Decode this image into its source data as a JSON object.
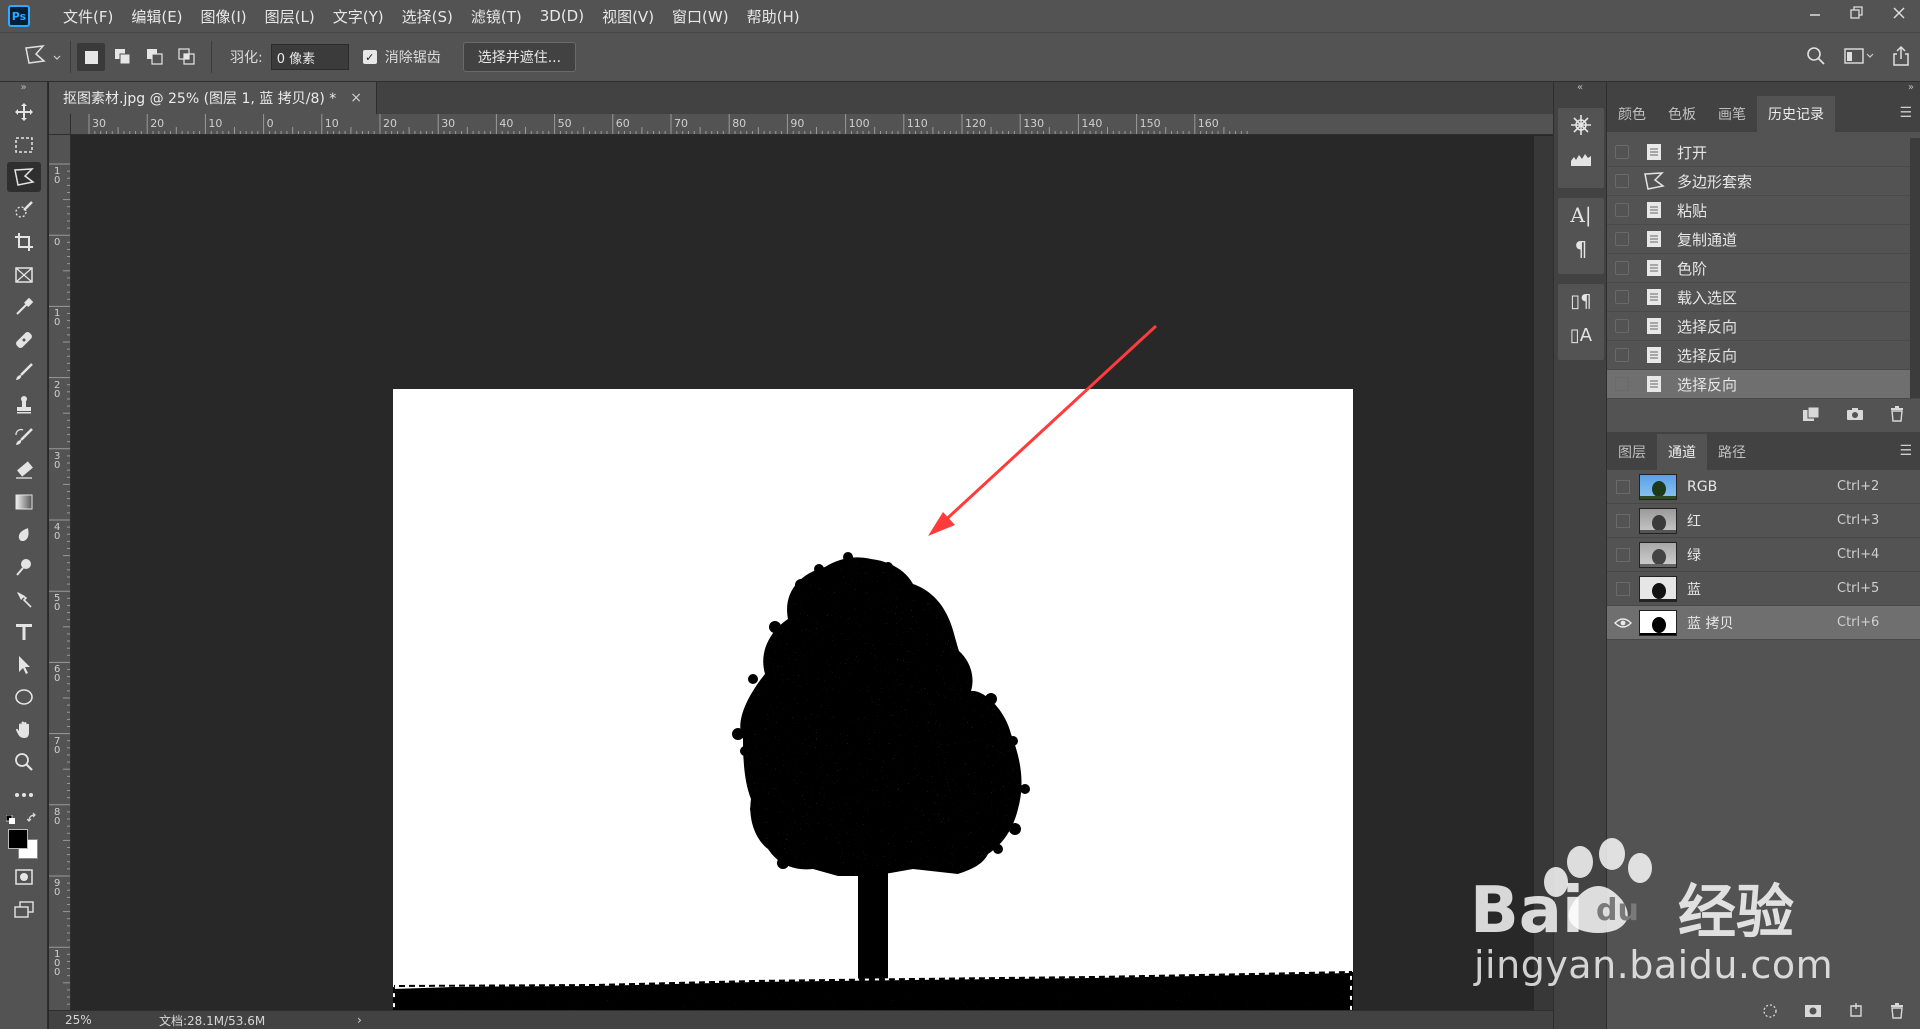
{
  "app": {
    "logo": "Ps",
    "menus": [
      "文件(F)",
      "编辑(E)",
      "图像(I)",
      "图层(L)",
      "文字(Y)",
      "选择(S)",
      "滤镜(T)",
      "3D(D)",
      "视图(V)",
      "窗口(W)",
      "帮助(H)"
    ],
    "window_controls": [
      "minimize-icon",
      "restore-icon",
      "close-icon"
    ]
  },
  "options": {
    "tool_icon": "polygonal-lasso-icon",
    "feather_label": "羽化:",
    "feather_value": "0 像素",
    "antialias_label": "消除锯齿",
    "antialias_checked": true,
    "select_mask_label": "选择并遮住...",
    "right_icons": [
      "search-icon",
      "workspace-icon",
      "share-icon"
    ]
  },
  "document": {
    "tab_title": "抠图素材.jpg @ 25% (图层 1, 蓝 拷贝/8) *",
    "close": "×",
    "ruler_top": [
      "30",
      "20",
      "10",
      "0",
      "10",
      "20",
      "30",
      "40",
      "50",
      "60",
      "70",
      "80",
      "90",
      "100",
      "110",
      "120",
      "130",
      "140",
      "150",
      "160"
    ],
    "ruler_left": [
      "10",
      "0",
      "10",
      "20",
      "30",
      "40",
      "50",
      "60",
      "70",
      "80",
      "90",
      "100"
    ],
    "zoom": "25%",
    "doc_info": "文档:28.1M/53.6M",
    "status_arrow": "›"
  },
  "history_panel": {
    "tabs": [
      "颜色",
      "色板",
      "画笔",
      "历史记录"
    ],
    "active_tab": 3,
    "items": [
      {
        "label": "打开",
        "icon": "document-icon"
      },
      {
        "label": "多边形套索",
        "icon": "polygonal-lasso-icon"
      },
      {
        "label": "粘贴",
        "icon": "document-icon"
      },
      {
        "label": "复制通道",
        "icon": "document-icon"
      },
      {
        "label": "色阶",
        "icon": "document-icon"
      },
      {
        "label": "载入选区",
        "icon": "document-icon"
      },
      {
        "label": "选择反向",
        "icon": "document-icon"
      },
      {
        "label": "选择反向",
        "icon": "document-icon"
      },
      {
        "label": "选择反向",
        "icon": "document-icon"
      }
    ],
    "footer_icons": [
      "new-document-from-state-icon",
      "snapshot-camera-icon",
      "trash-icon"
    ]
  },
  "channels_panel": {
    "tabs": [
      "图层",
      "通道",
      "路径"
    ],
    "active_tab": 1,
    "channels": [
      {
        "name": "RGB",
        "shortcut": "Ctrl+2",
        "visible": false,
        "thumb": "color"
      },
      {
        "name": "红",
        "shortcut": "Ctrl+3",
        "visible": false,
        "thumb": "gray"
      },
      {
        "name": "绿",
        "shortcut": "Ctrl+4",
        "visible": false,
        "thumb": "gray"
      },
      {
        "name": "蓝",
        "shortcut": "Ctrl+5",
        "visible": false,
        "thumb": "light"
      },
      {
        "name": "蓝 拷贝",
        "shortcut": "Ctrl+6",
        "visible": true,
        "thumb": "mask"
      }
    ],
    "footer_icons": [
      "load-selection-icon",
      "save-selection-icon",
      "new-channel-icon",
      "trash-icon"
    ]
  },
  "watermark": {
    "line1": "Bai",
    "line1b": "du",
    "line1c": "经验",
    "line2": "jingyan.baidu.com"
  },
  "colors": {
    "accent": "#31a8ff",
    "arrow": "#ff3b3b"
  }
}
